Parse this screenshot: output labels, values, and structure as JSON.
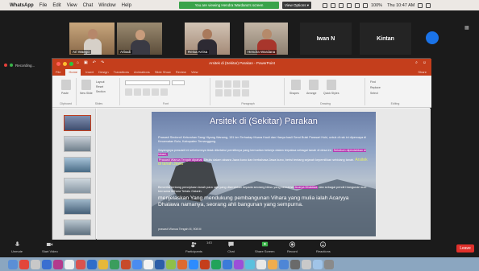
{
  "menubar": {
    "app": "WhatsApp",
    "items": [
      "File",
      "Edit",
      "View",
      "Chat",
      "Window",
      "Help"
    ],
    "share_banner": "You are viewing Hendra Wardana's screen",
    "view_options": "View Options ▾",
    "clock": "Thu 10:47 AM",
    "battery": "100%"
  },
  "gallery": {
    "participants": [
      {
        "name": "Ari Waego"
      },
      {
        "name": "Arbadi"
      },
      {
        "name": "Reisa Arrisa"
      },
      {
        "name": "Hendra Wardana"
      },
      {
        "name": "Iwan N"
      },
      {
        "name": "Kintan"
      }
    ],
    "next_icon": "chevron-right-icon"
  },
  "recording": {
    "label": "Recording..."
  },
  "powerpoint": {
    "title": "Arsitek di (Sekitar) Parakan - PowerPoint",
    "qat_icons": [
      "home-icon",
      "save-icon",
      "undo-icon",
      "redo-icon"
    ],
    "ribbon_tabs": [
      "File",
      "Home",
      "Insert",
      "Design",
      "Transitions",
      "Animations",
      "Slide Show",
      "Review",
      "View"
    ],
    "share": "Share",
    "groups": [
      "Clipboard",
      "Slides",
      "Font",
      "Paragraph",
      "Drawing",
      "Editing"
    ],
    "ribbon_labels": {
      "paste": "Paste",
      "new_slide": "New Slide",
      "layout": "Layout",
      "reset": "Reset",
      "section": "Section",
      "shapes": "Shapes",
      "arrange": "Arrange",
      "quick_styles": "Quick Styles",
      "find": "Find",
      "replace": "Replace",
      "select": "Select"
    }
  },
  "slide": {
    "title": "Arsitek di (Sekitar) Parakan",
    "para1": "Prasasti Sindoro/i Kelurahan Sang Hiyang Wanang, 151 km Terhadap Muara Kauli dan Hanya kauli Serui Bulsi Parasari Hoki, untuk di rak ini dipercaya di Kecamatan Bulu, Kabupaten Temanggung.",
    "para2": "Sayangnya prasasti ini sebelumnya tidak diketahui pemiliknya yang kemudian bekerja dalam terpaksa sebagai tanah di desa ini.",
    "para2_hl": "Sebelum dipindahkan di lokasi,",
    "para3_hl": "Prasasti Wanua Tengah dipahat",
    "para3": "Ditulis dalam aksara Jawa kuno dan berbahasa Jawa kuno, berisi tentang sejarah kepemilikan sebidang tanah.",
    "yellow": "Arsitek di tanah Jawa",
    "para4a": "Bercerita tentang penciptaan tanah para raja yang diserahkan kepada seorang biksu yang bernama",
    "para4_hl": "Acarya Dhalawa",
    "para4b": "dan sebagai pendiri bangunan suci bernama Wihara Terlalu Galanh.",
    "big": "menjelaskan Yang mendukung pembangunan Vihara yang mulia ialah Acaryya Dhalawa namanya, seorang ahli bangunan yang sempurna.",
    "small": "prasasti Wanua Tengah III, 908 M"
  },
  "controls": {
    "items": [
      {
        "label": "Unmute",
        "icon": "mic-icon"
      },
      {
        "label": "Start Video",
        "icon": "video-icon"
      },
      {
        "label": "Participants",
        "icon": "participants-icon",
        "count": "143"
      },
      {
        "label": "Chat",
        "icon": "chat-icon"
      },
      {
        "label": "Share Screen",
        "icon": "share-screen-icon"
      },
      {
        "label": "Record",
        "icon": "record-icon"
      },
      {
        "label": "Reactions",
        "icon": "reactions-icon"
      }
    ],
    "leave": "Leave"
  },
  "colors": {
    "ppt_accent": "#c43e1c",
    "share_green": "#3aa34a",
    "leave_red": "#e0302b",
    "zoom_blue": "#1a73e8"
  }
}
